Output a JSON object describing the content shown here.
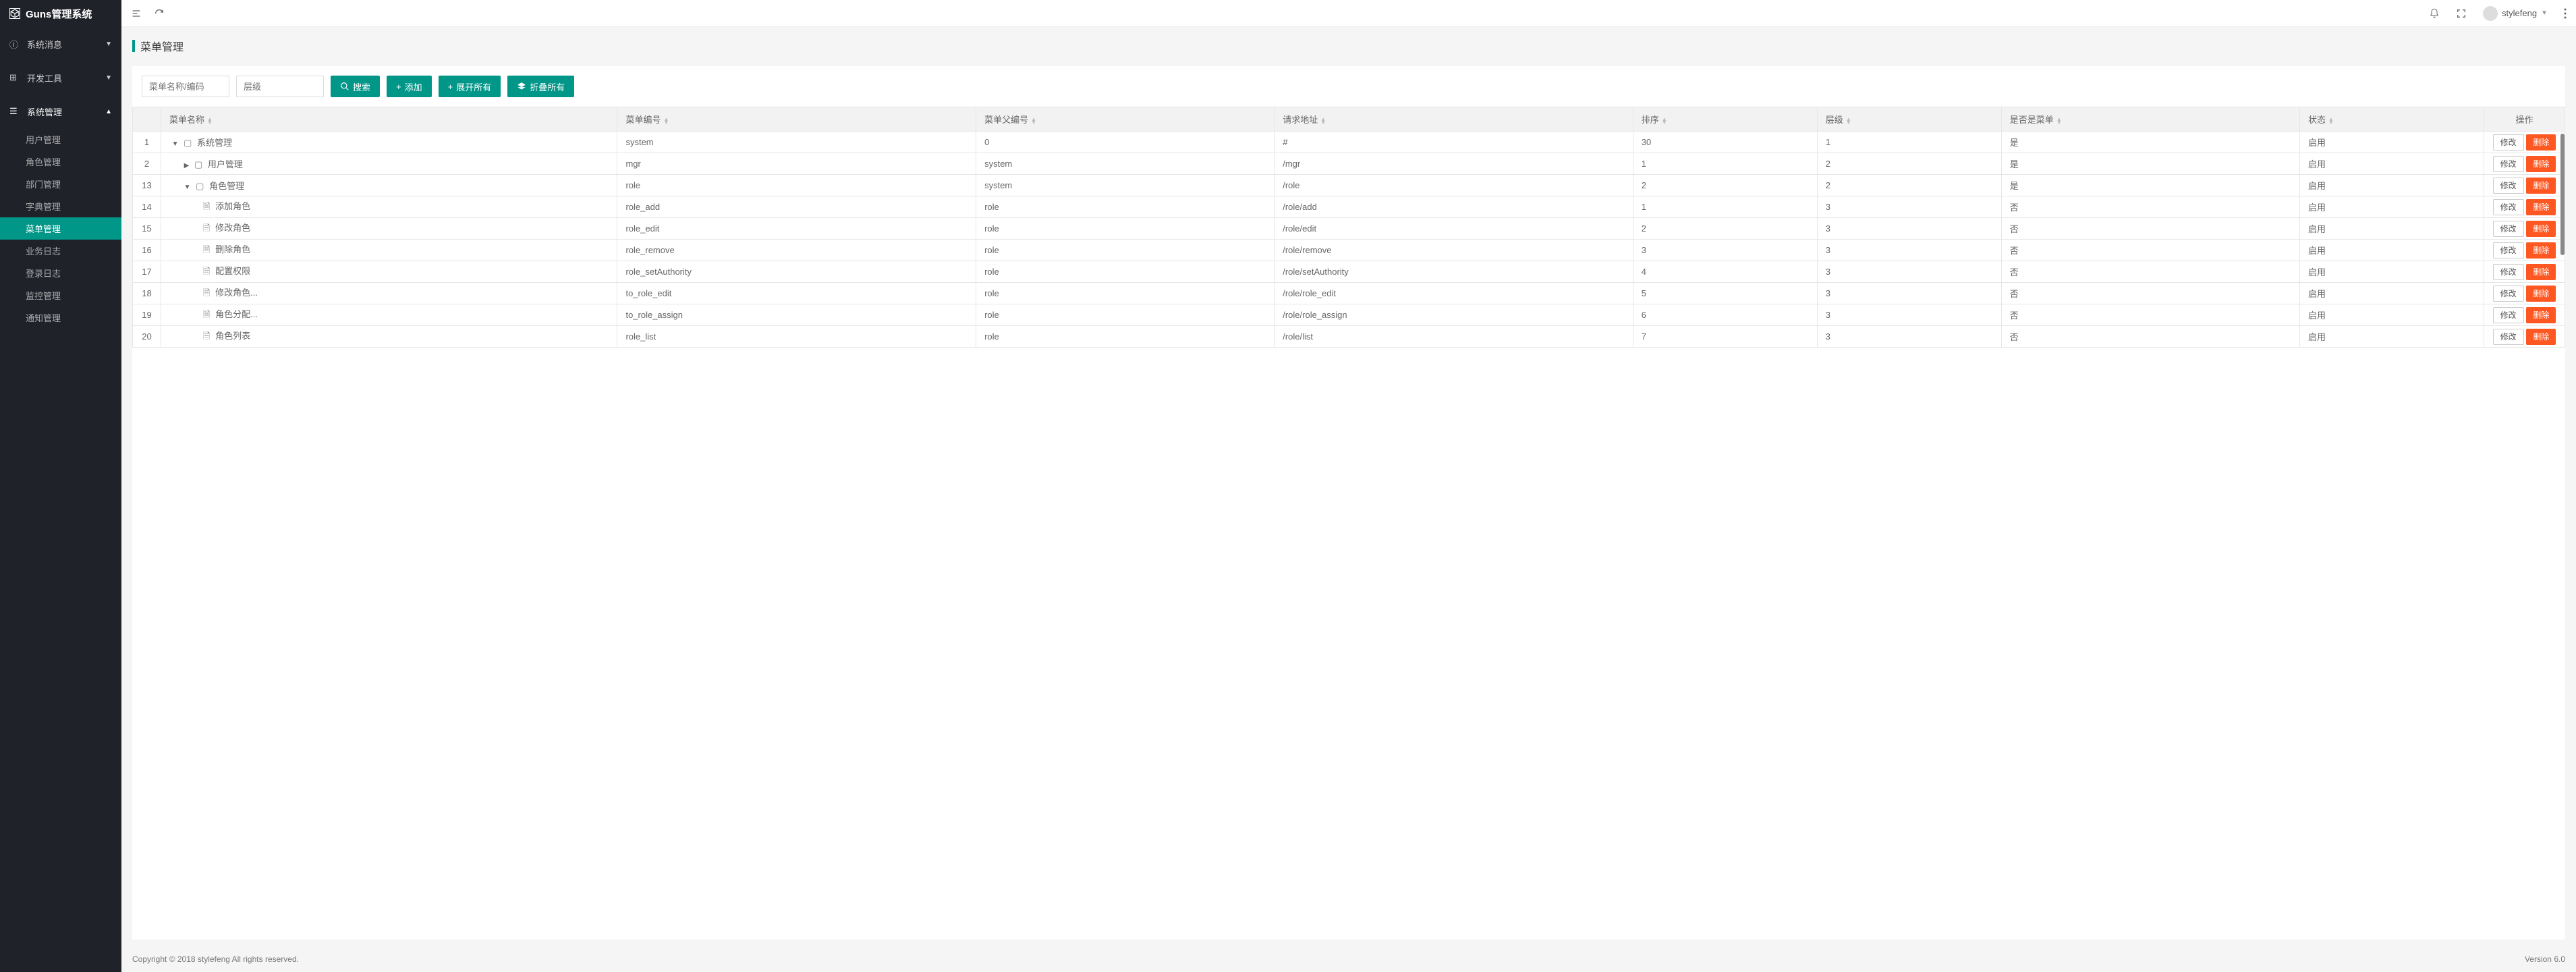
{
  "app": {
    "name": "Guns管理系统"
  },
  "header": {
    "username": "stylefeng"
  },
  "sidebar": {
    "groups": [
      {
        "label": "系统消息",
        "expanded": false
      },
      {
        "label": "开发工具",
        "expanded": false
      },
      {
        "label": "系统管理",
        "expanded": true,
        "items": [
          {
            "label": "用户管理"
          },
          {
            "label": "角色管理"
          },
          {
            "label": "部门管理"
          },
          {
            "label": "字典管理"
          },
          {
            "label": "菜单管理",
            "active": true
          },
          {
            "label": "业务日志"
          },
          {
            "label": "登录日志"
          },
          {
            "label": "监控管理"
          },
          {
            "label": "通知管理"
          }
        ]
      }
    ]
  },
  "page": {
    "title": "菜单管理"
  },
  "toolbar": {
    "name_placeholder": "菜单名称/编码",
    "level_placeholder": "层级",
    "search": "搜索",
    "add": "添加",
    "expand_all": "展开所有",
    "collapse_all": "折叠所有"
  },
  "table": {
    "columns": {
      "index": "",
      "name": "菜单名称",
      "code": "菜单编号",
      "parent": "菜单父编号",
      "url": "请求地址",
      "sort": "排序",
      "level": "层级",
      "is_menu": "是否是菜单",
      "status": "状态",
      "action": "操作"
    },
    "actions": {
      "edit": "修改",
      "delete": "删除"
    },
    "rows": [
      {
        "idx": "1",
        "indent": 0,
        "toggle": "down",
        "folder": true,
        "name": "系统管理",
        "code": "system",
        "parent": "0",
        "url": "#",
        "sort": "30",
        "level": "1",
        "is_menu": "是",
        "status": "启用"
      },
      {
        "idx": "2",
        "indent": 1,
        "toggle": "right",
        "folder": true,
        "name": "用户管理",
        "code": "mgr",
        "parent": "system",
        "url": "/mgr",
        "sort": "1",
        "level": "2",
        "is_menu": "是",
        "status": "启用"
      },
      {
        "idx": "13",
        "indent": 1,
        "toggle": "down",
        "folder": true,
        "name": "角色管理",
        "code": "role",
        "parent": "system",
        "url": "/role",
        "sort": "2",
        "level": "2",
        "is_menu": "是",
        "status": "启用"
      },
      {
        "idx": "14",
        "indent": 2,
        "toggle": "",
        "folder": false,
        "name": "添加角色",
        "code": "role_add",
        "parent": "role",
        "url": "/role/add",
        "sort": "1",
        "level": "3",
        "is_menu": "否",
        "status": "启用"
      },
      {
        "idx": "15",
        "indent": 2,
        "toggle": "",
        "folder": false,
        "name": "修改角色",
        "code": "role_edit",
        "parent": "role",
        "url": "/role/edit",
        "sort": "2",
        "level": "3",
        "is_menu": "否",
        "status": "启用"
      },
      {
        "idx": "16",
        "indent": 2,
        "toggle": "",
        "folder": false,
        "name": "删除角色",
        "code": "role_remove",
        "parent": "role",
        "url": "/role/remove",
        "sort": "3",
        "level": "3",
        "is_menu": "否",
        "status": "启用"
      },
      {
        "idx": "17",
        "indent": 2,
        "toggle": "",
        "folder": false,
        "name": "配置权限",
        "code": "role_setAuthority",
        "parent": "role",
        "url": "/role/setAuthority",
        "sort": "4",
        "level": "3",
        "is_menu": "否",
        "status": "启用"
      },
      {
        "idx": "18",
        "indent": 2,
        "toggle": "",
        "folder": false,
        "name": "修改角色...",
        "code": "to_role_edit",
        "parent": "role",
        "url": "/role/role_edit",
        "sort": "5",
        "level": "3",
        "is_menu": "否",
        "status": "启用"
      },
      {
        "idx": "19",
        "indent": 2,
        "toggle": "",
        "folder": false,
        "name": "角色分配...",
        "code": "to_role_assign",
        "parent": "role",
        "url": "/role/role_assign",
        "sort": "6",
        "level": "3",
        "is_menu": "否",
        "status": "启用"
      },
      {
        "idx": "20",
        "indent": 2,
        "toggle": "",
        "folder": false,
        "name": "角色列表",
        "code": "role_list",
        "parent": "role",
        "url": "/role/list",
        "sort": "7",
        "level": "3",
        "is_menu": "否",
        "status": "启用"
      }
    ]
  },
  "footer": {
    "copyright": "Copyright © 2018 stylefeng All rights reserved.",
    "version": "Version 6.0"
  }
}
